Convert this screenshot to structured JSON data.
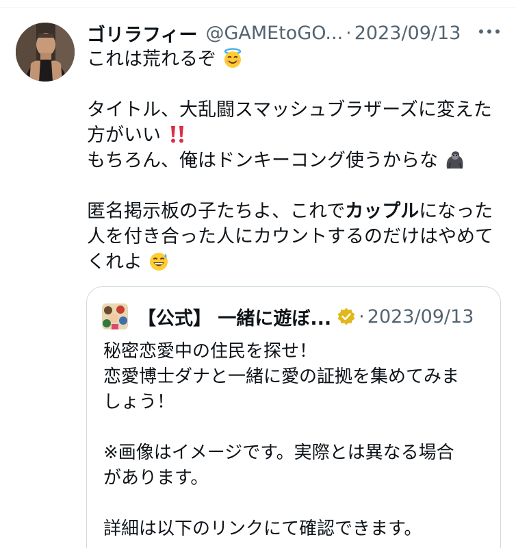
{
  "tweet": {
    "display_name": "ゴリラフィー",
    "handle": "@GAMEtoGO...",
    "separator": "·",
    "date": "2023/09/13",
    "lines": [
      "これは荒れるぞ",
      "",
      "タイトル、大乱闘スマッシュブラザーズに変えた",
      "方がいい",
      "もちろん、俺はドンキーコング使うからな",
      "",
      "匿名掲示板の子たちよ、これで",
      "カップル",
      "になった",
      "人を付き合った人にカウントするのだけはやめて",
      "くれよ"
    ],
    "emojis": {
      "line1": "halo-face-emoji",
      "line4": "double-exclamation-emoji",
      "line5": "gorilla-emoji",
      "line11": "sweat-smile-emoji"
    }
  },
  "quote": {
    "name": "【公式】 一緒に遊ぼ...",
    "separator": "·",
    "date": "2023/09/13",
    "lines": [
      "秘密恋愛中の住民を探せ！",
      "恋愛博士ダナと一緒に愛の証拠を集めてみま",
      "しょう！",
      "",
      "※画像はイメージです。実際とは異なる場合",
      "があります。",
      "",
      "詳細は以下のリンクにて確認できます。"
    ]
  },
  "colors": {
    "text": "#0f1419",
    "secondary": "#536471",
    "border": "#cfd9de",
    "verified": "#e2b719"
  }
}
